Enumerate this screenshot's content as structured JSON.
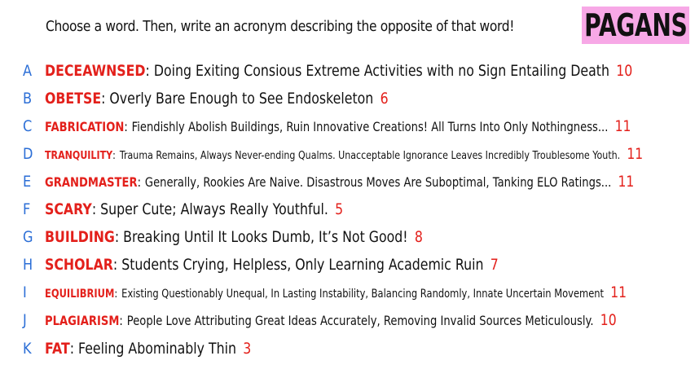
{
  "prompt": "Choose a word. Then, write an acronym describing the opposite of that word!",
  "logo": "PAGANS",
  "colors": {
    "word": "#e3201b",
    "letter": "#2b6ed6",
    "logo_bg": "#f7a8e6"
  },
  "entries": [
    {
      "letter": "A",
      "word": "DECEAWNSED",
      "acronym": "Doing Exiting Consious Extreme Activities with no Sign Entailing Death",
      "count": "10"
    },
    {
      "letter": "B",
      "word": "OBETSE",
      "acronym": "Overly Bare Enough to See Endoskeleton",
      "count": "6"
    },
    {
      "letter": "C",
      "word": "FABRICATION",
      "acronym": "Fiendishly Abolish Buildings, Ruin Innovative Creations! All Turns Into Only Nothingness...",
      "count": "11"
    },
    {
      "letter": "D",
      "word": "TRANQUILITY",
      "acronym": "Trauma Remains, Always Never-ending Qualms. Unacceptable Ignorance Leaves Incredibly Troublesome Youth.",
      "count": "11"
    },
    {
      "letter": "E",
      "word": "GRANDMASTER",
      "acronym": "Generally, Rookies Are Naive. Disastrous Moves Are Suboptimal, Tanking ELO Ratings...",
      "count": "11"
    },
    {
      "letter": "F",
      "word": "SCARY",
      "acronym": "Super Cute; Always Really Youthful.",
      "count": "5"
    },
    {
      "letter": "G",
      "word": "BUILDING",
      "acronym": "Breaking Until It Looks Dumb, It’s Not Good!",
      "count": "8"
    },
    {
      "letter": "H",
      "word": "SCHOLAR",
      "acronym": "Students Crying, Helpless, Only Learning Academic Ruin",
      "count": "7"
    },
    {
      "letter": "I",
      "word": "EQUILIBRIUM",
      "acronym": "Existing Questionably Unequal, In Lasting Instability, Balancing Randomly, Innate Uncertain Movement",
      "count": "11"
    },
    {
      "letter": "J",
      "word": "PLAGIARISM",
      "acronym": "People Love Attributing Great Ideas Accurately, Removing Invalid Sources Meticulously.",
      "count": "10"
    },
    {
      "letter": "K",
      "word": "FAT",
      "acronym": "Feeling Abominably Thin",
      "count": "3"
    }
  ]
}
